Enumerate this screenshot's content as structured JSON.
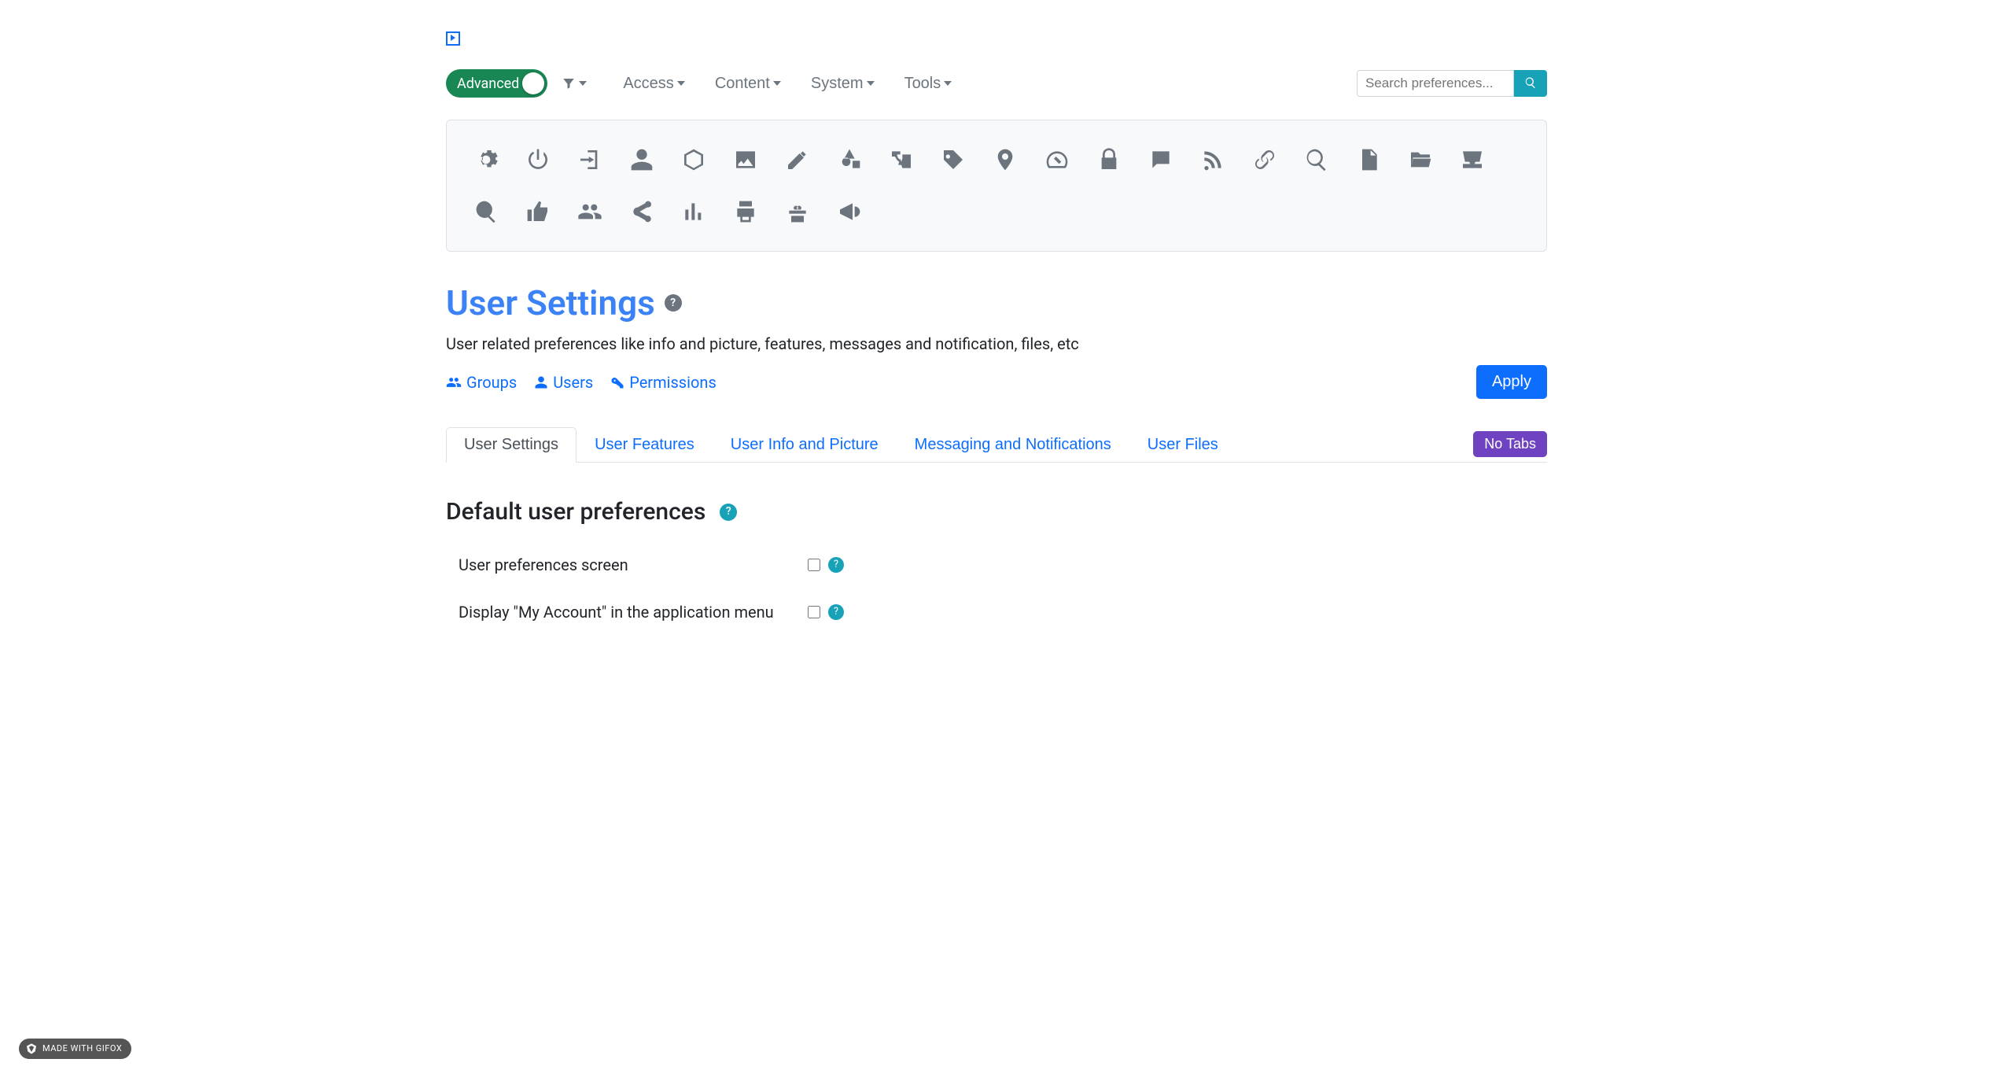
{
  "toolbar": {
    "advanced_label": "Advanced",
    "menus": [
      "Access",
      "Content",
      "System",
      "Tools"
    ],
    "search_placeholder": "Search preferences..."
  },
  "icons": [
    "gear",
    "power",
    "login",
    "user",
    "cube",
    "image",
    "edit",
    "shapes",
    "language",
    "tag",
    "map-pin",
    "gauge",
    "lock",
    "comment",
    "rss",
    "link",
    "search",
    "file",
    "folder-open",
    "inbox",
    "zoom-in",
    "thumbs-up",
    "group",
    "share",
    "bar-chart",
    "print",
    "gift",
    "bullhorn"
  ],
  "page": {
    "title": "User Settings",
    "description": "User related preferences like info and picture, features, messages and notification, files, etc"
  },
  "links": {
    "groups": "Groups",
    "users": "Users",
    "permissions": "Permissions"
  },
  "buttons": {
    "apply": "Apply",
    "no_tabs": "No Tabs"
  },
  "tabs": [
    "User Settings",
    "User Features",
    "User Info and Picture",
    "Messaging and Notifications",
    "User Files"
  ],
  "section": {
    "title": "Default user preferences",
    "fields": [
      {
        "label": "User preferences screen",
        "checked": false
      },
      {
        "label": "Display \"My Account\" in the application menu",
        "checked": false
      }
    ]
  },
  "badge": "MADE WITH GIFOX"
}
